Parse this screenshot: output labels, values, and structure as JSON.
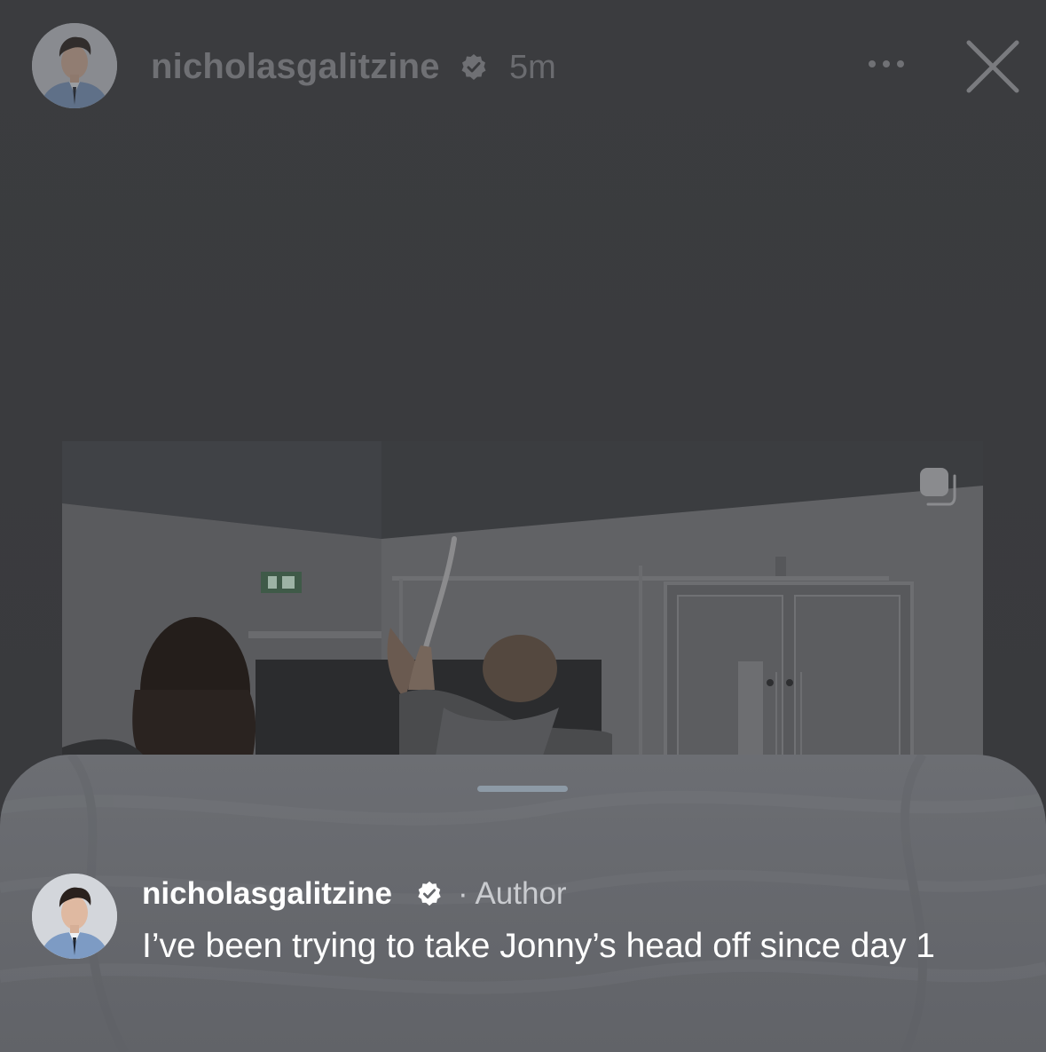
{
  "story": {
    "username": "nicholasgalitzine",
    "time_ago": "5m",
    "verified": true,
    "more_icon": "more-horizontal-icon",
    "close_icon": "close-icon"
  },
  "media": {
    "type": "video",
    "multi_icon": "multiple-posts-icon"
  },
  "comment": {
    "username": "nicholasgalitzine",
    "verified": true,
    "role_tag": "· Author",
    "text": "I’ve been trying to take Jonny’s head off since day 1"
  },
  "colors": {
    "background": "#3a3b3e",
    "sheet": "#66686d",
    "handle": "#8d9aa6",
    "header_text": "#6f7074",
    "comment_text": "#ffffff"
  }
}
